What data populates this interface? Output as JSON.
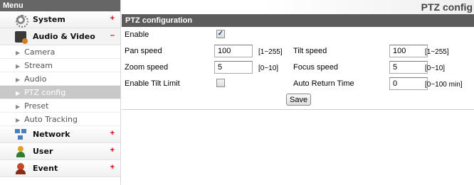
{
  "sidebar": {
    "header": "Menu",
    "categories": [
      {
        "label": "System",
        "sign": "+",
        "icon": "gear-icon"
      },
      {
        "label": "Audio & Video",
        "sign": "–",
        "icon": "camera-icon"
      },
      {
        "label": "Network",
        "sign": "+",
        "icon": "network-icon"
      },
      {
        "label": "User",
        "sign": "+",
        "icon": "user-icon"
      },
      {
        "label": "Event",
        "sign": "+",
        "icon": "event-icon"
      }
    ],
    "sub_items": [
      {
        "label": "Camera"
      },
      {
        "label": "Stream"
      },
      {
        "label": "Audio"
      },
      {
        "label": "PTZ config",
        "active": true
      },
      {
        "label": "Preset"
      },
      {
        "label": "Auto Tracking"
      }
    ],
    "arrow_glyph": "▶"
  },
  "main": {
    "page_title": "PTZ config",
    "section_title": "PTZ configuration",
    "enable": {
      "label": "Enable",
      "checked": true
    },
    "pan_speed": {
      "label": "Pan speed",
      "value": "100",
      "hint": "[1~255]"
    },
    "tilt_speed": {
      "label": "Tilt speed",
      "value": "100",
      "hint": "[1~255]"
    },
    "zoom_speed": {
      "label": "Zoom speed",
      "value": "5",
      "hint": "[0~10]"
    },
    "focus_speed": {
      "label": "Focus speed",
      "value": "5",
      "hint": "[0~10]"
    },
    "enable_tilt_limit": {
      "label": "Enable Tilt Limit",
      "checked": false
    },
    "auto_return_time": {
      "label": "Auto Return Time",
      "value": "0",
      "hint": "[0~100 min]"
    },
    "save_label": "Save"
  },
  "colors": {
    "header_bg": "#5c5c5c",
    "active_item_bg": "#c8c8c8",
    "sign_color": "#dd0000"
  }
}
